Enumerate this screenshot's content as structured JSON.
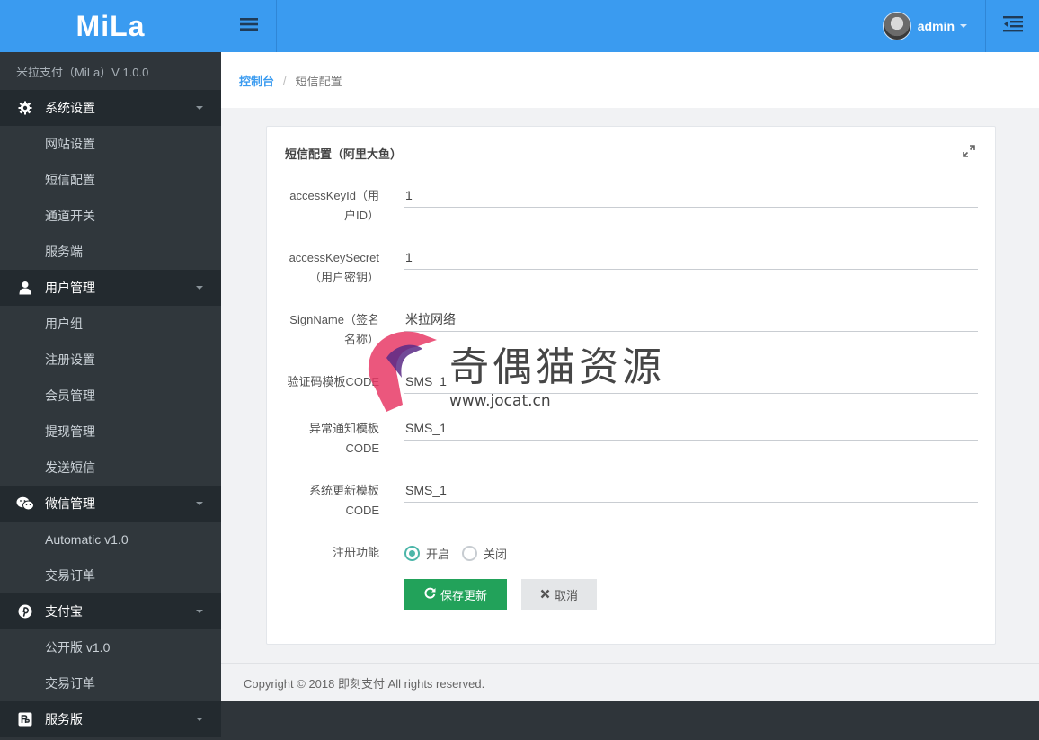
{
  "sidebar": {
    "logo": "MiLa",
    "version": "米拉支付（MiLa）V 1.0.0",
    "groups": [
      {
        "icon": "gear-icon",
        "label": "系统设置",
        "items": [
          "网站设置",
          "短信配置",
          "通道开关",
          "服务端"
        ]
      },
      {
        "icon": "user-icon",
        "label": "用户管理",
        "items": [
          "用户组",
          "注册设置",
          "会员管理",
          "提现管理",
          "发送短信"
        ]
      },
      {
        "icon": "wechat-icon",
        "label": "微信管理",
        "items": [
          "Automatic v1.0",
          "交易订单"
        ]
      },
      {
        "icon": "pinterest-icon",
        "label": "支付宝",
        "items": [
          "公开版 v1.0",
          "交易订单"
        ]
      },
      {
        "icon": "service-icon",
        "label": "服务版",
        "items": []
      }
    ]
  },
  "topbar": {
    "username": "admin"
  },
  "breadcrumb": {
    "home": "控制台",
    "current": "短信配置"
  },
  "panel": {
    "title": "短信配置（阿里大鱼）",
    "fields": [
      {
        "label": "accessKeyId（用户ID）",
        "value": "1"
      },
      {
        "label": "accessKeySecret（用户密钥）",
        "value": "1"
      },
      {
        "label": "SignName（签名名称）",
        "value": "米拉网络"
      },
      {
        "label": "验证码模板CODE",
        "value": "SMS_1"
      },
      {
        "label": "异常通知模板CODE",
        "value": "SMS_1"
      },
      {
        "label": "系统更新模板CODE",
        "value": "SMS_1"
      }
    ],
    "register": {
      "label": "注册功能",
      "on_label": "开启",
      "off_label": "关闭",
      "selected": "on"
    },
    "save_label": "保存更新",
    "cancel_label": "取消"
  },
  "footer": {
    "text": "Copyright © 2018 即刻支付 All rights reserved."
  },
  "watermark": {
    "text": "奇偶猫资源",
    "url": "www.jocat.cn"
  },
  "colors": {
    "accent": "#3a9bf0",
    "sidebar": "#2f353a",
    "save": "#22a25a",
    "radio": "#4cb6a9"
  }
}
